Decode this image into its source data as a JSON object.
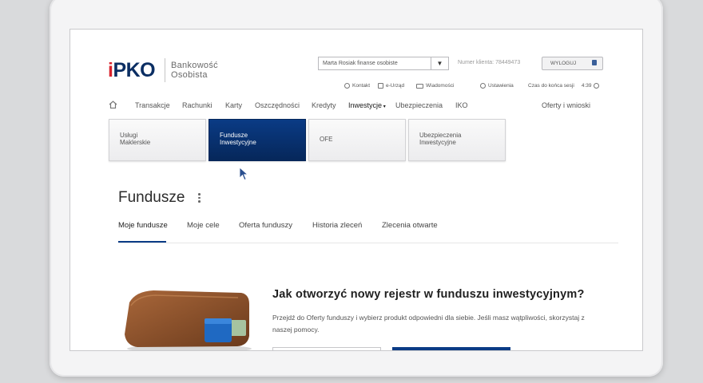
{
  "header": {
    "logo_prefix": "i",
    "logo_main": "PKO",
    "product_line1": "Bankowość",
    "product_line2": "Osobista",
    "context_select_value": "Marta Rosiak finanse osobiste",
    "client_number": "Numer klienta: 78449473",
    "logout_label": "WYLOGUJ"
  },
  "utility": {
    "contact": "Kontakt",
    "eoffice": "e-Urząd",
    "messages": "Wiadomości",
    "settings": "Ustawienia",
    "session_label": "Czas do końca sesji",
    "session_time": "4:39"
  },
  "nav": {
    "items": [
      "Transakcje",
      "Rachunki",
      "Karty",
      "Oszczędności",
      "Kredyty",
      "Inwestycje",
      "Ubezpieczenia",
      "IKO"
    ],
    "active": "Inwestycje",
    "right_link": "Oferty i wnioski"
  },
  "tiles": [
    {
      "line1": "Usługi",
      "line2": "Maklerskie"
    },
    {
      "line1": "Fundusze",
      "line2": "Inwestycyjne"
    },
    {
      "line1": "OFE",
      "line2": ""
    },
    {
      "line1": "Ubezpieczenia",
      "line2": "Inwestycyjne"
    }
  ],
  "page": {
    "title": "Fundusze",
    "tabs": [
      "Moje fundusze",
      "Moje cele",
      "Oferta funduszy",
      "Historia zleceń",
      "Zlecenia otwarte"
    ],
    "active_tab": "Moje fundusze"
  },
  "promo": {
    "title": "Jak otworzyć nowy rejestr w funduszu inwestycyjnym?",
    "text": "Przejdź do Oferty funduszy i wybierz produkt odpowiedni dla siebie. Jeśli masz wątpliwości, skorzystaj z naszej pomocy."
  },
  "colors": {
    "brand_navy": "#0a3b85",
    "logo_red": "#d9232d"
  }
}
